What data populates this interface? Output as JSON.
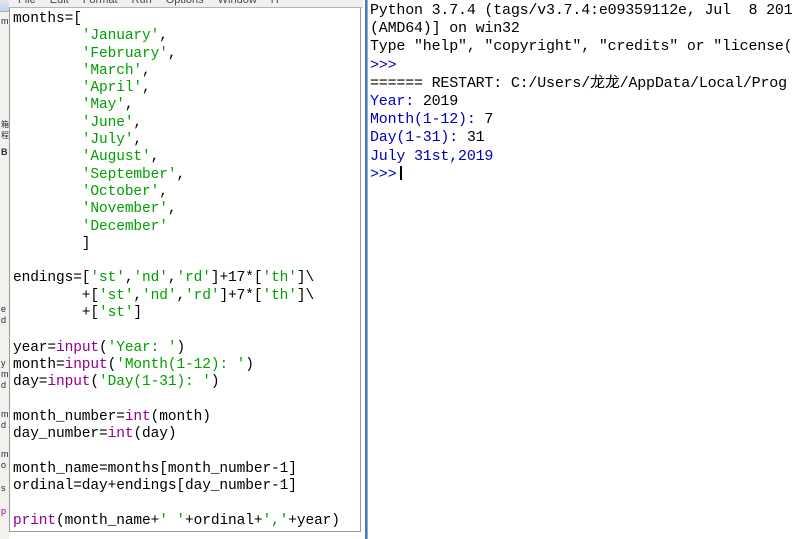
{
  "background_window": {
    "name": "partially-occluded-background-window",
    "visible_fragments": [
      "箱",
      "程",
      "B",
      "e",
      "d",
      "y",
      "m",
      "d",
      "m",
      "d",
      "m",
      "o",
      "s",
      "p"
    ]
  },
  "editor": {
    "window_name": "python-idle-editor",
    "menubar": [
      {
        "label": "File"
      },
      {
        "label": "Edit"
      },
      {
        "label": "Format"
      },
      {
        "label": "Run"
      },
      {
        "label": "Options"
      },
      {
        "label": "Window"
      },
      {
        "label": "H"
      }
    ],
    "code_lines": [
      {
        "segments": [
          {
            "t": "months=[",
            "c": "tok-plain"
          }
        ]
      },
      {
        "segments": [
          {
            "t": "        ",
            "c": "tok-plain"
          },
          {
            "t": "'January'",
            "c": "tok-str"
          },
          {
            "t": ",",
            "c": "tok-plain"
          }
        ]
      },
      {
        "segments": [
          {
            "t": "        ",
            "c": "tok-plain"
          },
          {
            "t": "'February'",
            "c": "tok-str"
          },
          {
            "t": ",",
            "c": "tok-plain"
          }
        ]
      },
      {
        "segments": [
          {
            "t": "        ",
            "c": "tok-plain"
          },
          {
            "t": "'March'",
            "c": "tok-str"
          },
          {
            "t": ",",
            "c": "tok-plain"
          }
        ]
      },
      {
        "segments": [
          {
            "t": "        ",
            "c": "tok-plain"
          },
          {
            "t": "'April'",
            "c": "tok-str"
          },
          {
            "t": ",",
            "c": "tok-plain"
          }
        ]
      },
      {
        "segments": [
          {
            "t": "        ",
            "c": "tok-plain"
          },
          {
            "t": "'May'",
            "c": "tok-str"
          },
          {
            "t": ",",
            "c": "tok-plain"
          }
        ]
      },
      {
        "segments": [
          {
            "t": "        ",
            "c": "tok-plain"
          },
          {
            "t": "'June'",
            "c": "tok-str"
          },
          {
            "t": ",",
            "c": "tok-plain"
          }
        ]
      },
      {
        "segments": [
          {
            "t": "        ",
            "c": "tok-plain"
          },
          {
            "t": "'July'",
            "c": "tok-str"
          },
          {
            "t": ",",
            "c": "tok-plain"
          }
        ]
      },
      {
        "segments": [
          {
            "t": "        ",
            "c": "tok-plain"
          },
          {
            "t": "'August'",
            "c": "tok-str"
          },
          {
            "t": ",",
            "c": "tok-plain"
          }
        ]
      },
      {
        "segments": [
          {
            "t": "        ",
            "c": "tok-plain"
          },
          {
            "t": "'September'",
            "c": "tok-str"
          },
          {
            "t": ",",
            "c": "tok-plain"
          }
        ]
      },
      {
        "segments": [
          {
            "t": "        ",
            "c": "tok-plain"
          },
          {
            "t": "'October'",
            "c": "tok-str"
          },
          {
            "t": ",",
            "c": "tok-plain"
          }
        ]
      },
      {
        "segments": [
          {
            "t": "        ",
            "c": "tok-plain"
          },
          {
            "t": "'November'",
            "c": "tok-str"
          },
          {
            "t": ",",
            "c": "tok-plain"
          }
        ]
      },
      {
        "segments": [
          {
            "t": "        ",
            "c": "tok-plain"
          },
          {
            "t": "'December'",
            "c": "tok-str"
          }
        ]
      },
      {
        "segments": [
          {
            "t": "        ]",
            "c": "tok-plain"
          }
        ]
      },
      {
        "segments": []
      },
      {
        "segments": [
          {
            "t": "endings=[",
            "c": "tok-plain"
          },
          {
            "t": "'st'",
            "c": "tok-str"
          },
          {
            "t": ",",
            "c": "tok-plain"
          },
          {
            "t": "'nd'",
            "c": "tok-str"
          },
          {
            "t": ",",
            "c": "tok-plain"
          },
          {
            "t": "'rd'",
            "c": "tok-str"
          },
          {
            "t": "]+17*[",
            "c": "tok-plain"
          },
          {
            "t": "'th'",
            "c": "tok-str"
          },
          {
            "t": "]\\",
            "c": "tok-plain"
          }
        ]
      },
      {
        "segments": [
          {
            "t": "        +[",
            "c": "tok-plain"
          },
          {
            "t": "'st'",
            "c": "tok-str"
          },
          {
            "t": ",",
            "c": "tok-plain"
          },
          {
            "t": "'nd'",
            "c": "tok-str"
          },
          {
            "t": ",",
            "c": "tok-plain"
          },
          {
            "t": "'rd'",
            "c": "tok-str"
          },
          {
            "t": "]+7*[",
            "c": "tok-plain"
          },
          {
            "t": "'th'",
            "c": "tok-str"
          },
          {
            "t": "]\\",
            "c": "tok-plain"
          }
        ]
      },
      {
        "segments": [
          {
            "t": "        +[",
            "c": "tok-plain"
          },
          {
            "t": "'st'",
            "c": "tok-str"
          },
          {
            "t": "]",
            "c": "tok-plain"
          }
        ]
      },
      {
        "segments": []
      },
      {
        "segments": [
          {
            "t": "year=",
            "c": "tok-plain"
          },
          {
            "t": "input",
            "c": "tok-builtin"
          },
          {
            "t": "(",
            "c": "tok-plain"
          },
          {
            "t": "'Year: '",
            "c": "tok-str"
          },
          {
            "t": ")",
            "c": "tok-plain"
          }
        ]
      },
      {
        "segments": [
          {
            "t": "month=",
            "c": "tok-plain"
          },
          {
            "t": "input",
            "c": "tok-builtin"
          },
          {
            "t": "(",
            "c": "tok-plain"
          },
          {
            "t": "'Month(1-12): '",
            "c": "tok-str"
          },
          {
            "t": ")",
            "c": "tok-plain"
          }
        ]
      },
      {
        "segments": [
          {
            "t": "day=",
            "c": "tok-plain"
          },
          {
            "t": "input",
            "c": "tok-builtin"
          },
          {
            "t": "(",
            "c": "tok-plain"
          },
          {
            "t": "'Day(1-31): '",
            "c": "tok-str"
          },
          {
            "t": ")",
            "c": "tok-plain"
          }
        ]
      },
      {
        "segments": []
      },
      {
        "segments": [
          {
            "t": "month_number=",
            "c": "tok-plain"
          },
          {
            "t": "int",
            "c": "tok-builtin"
          },
          {
            "t": "(month)",
            "c": "tok-plain"
          }
        ]
      },
      {
        "segments": [
          {
            "t": "day_number=",
            "c": "tok-plain"
          },
          {
            "t": "int",
            "c": "tok-builtin"
          },
          {
            "t": "(day)",
            "c": "tok-plain"
          }
        ]
      },
      {
        "segments": []
      },
      {
        "segments": [
          {
            "t": "month_name=months[month_number-1]",
            "c": "tok-plain"
          }
        ]
      },
      {
        "segments": [
          {
            "t": "ordinal=day+endings[day_number-1]",
            "c": "tok-plain"
          }
        ]
      },
      {
        "segments": []
      },
      {
        "segments": [
          {
            "t": "print",
            "c": "tok-builtin"
          },
          {
            "t": "(month_name+",
            "c": "tok-plain"
          },
          {
            "t": "' '",
            "c": "tok-str"
          },
          {
            "t": "+ordinal+",
            "c": "tok-plain"
          },
          {
            "t": "','",
            "c": "tok-str"
          },
          {
            "t": "+year)",
            "c": "tok-plain"
          }
        ]
      }
    ]
  },
  "shell": {
    "window_name": "python-idle-shell",
    "lines": [
      {
        "segments": [
          {
            "t": "Python 3.7.4 (tags/v3.7.4:e09359112e, Jul  8 201",
            "c": "sh-in"
          }
        ]
      },
      {
        "segments": [
          {
            "t": "(AMD64)] on win32",
            "c": "sh-in"
          }
        ]
      },
      {
        "segments": [
          {
            "t": "Type \"help\", \"copyright\", \"credits\" or \"license(",
            "c": "sh-in"
          }
        ]
      },
      {
        "segments": [
          {
            "t": ">>>",
            "c": "sh-prompt"
          }
        ]
      },
      {
        "segments": [
          {
            "t": "====== RESTART: C:/Users/龙龙/AppData/Local/Prog",
            "c": "sh-restart"
          }
        ]
      },
      {
        "segments": [
          {
            "t": "Year: ",
            "c": "sh-out"
          },
          {
            "t": "2019",
            "c": "sh-in"
          }
        ]
      },
      {
        "segments": [
          {
            "t": "Month(1-12): ",
            "c": "sh-out"
          },
          {
            "t": "7",
            "c": "sh-in"
          }
        ]
      },
      {
        "segments": [
          {
            "t": "Day(1-31): ",
            "c": "sh-out"
          },
          {
            "t": "31",
            "c": "sh-in"
          }
        ]
      },
      {
        "segments": [
          {
            "t": "July 31st,2019",
            "c": "sh-out"
          }
        ]
      },
      {
        "segments": [
          {
            "t": ">>>",
            "c": "sh-prompt"
          },
          {
            "t": "__CARET__",
            "c": "caret"
          }
        ]
      }
    ]
  },
  "colors": {
    "string_green": "#00a000",
    "builtin_purple": "#900090",
    "shell_blue": "#0000bb",
    "active_window_border": "#4a78b4",
    "background": "#ffffff"
  }
}
